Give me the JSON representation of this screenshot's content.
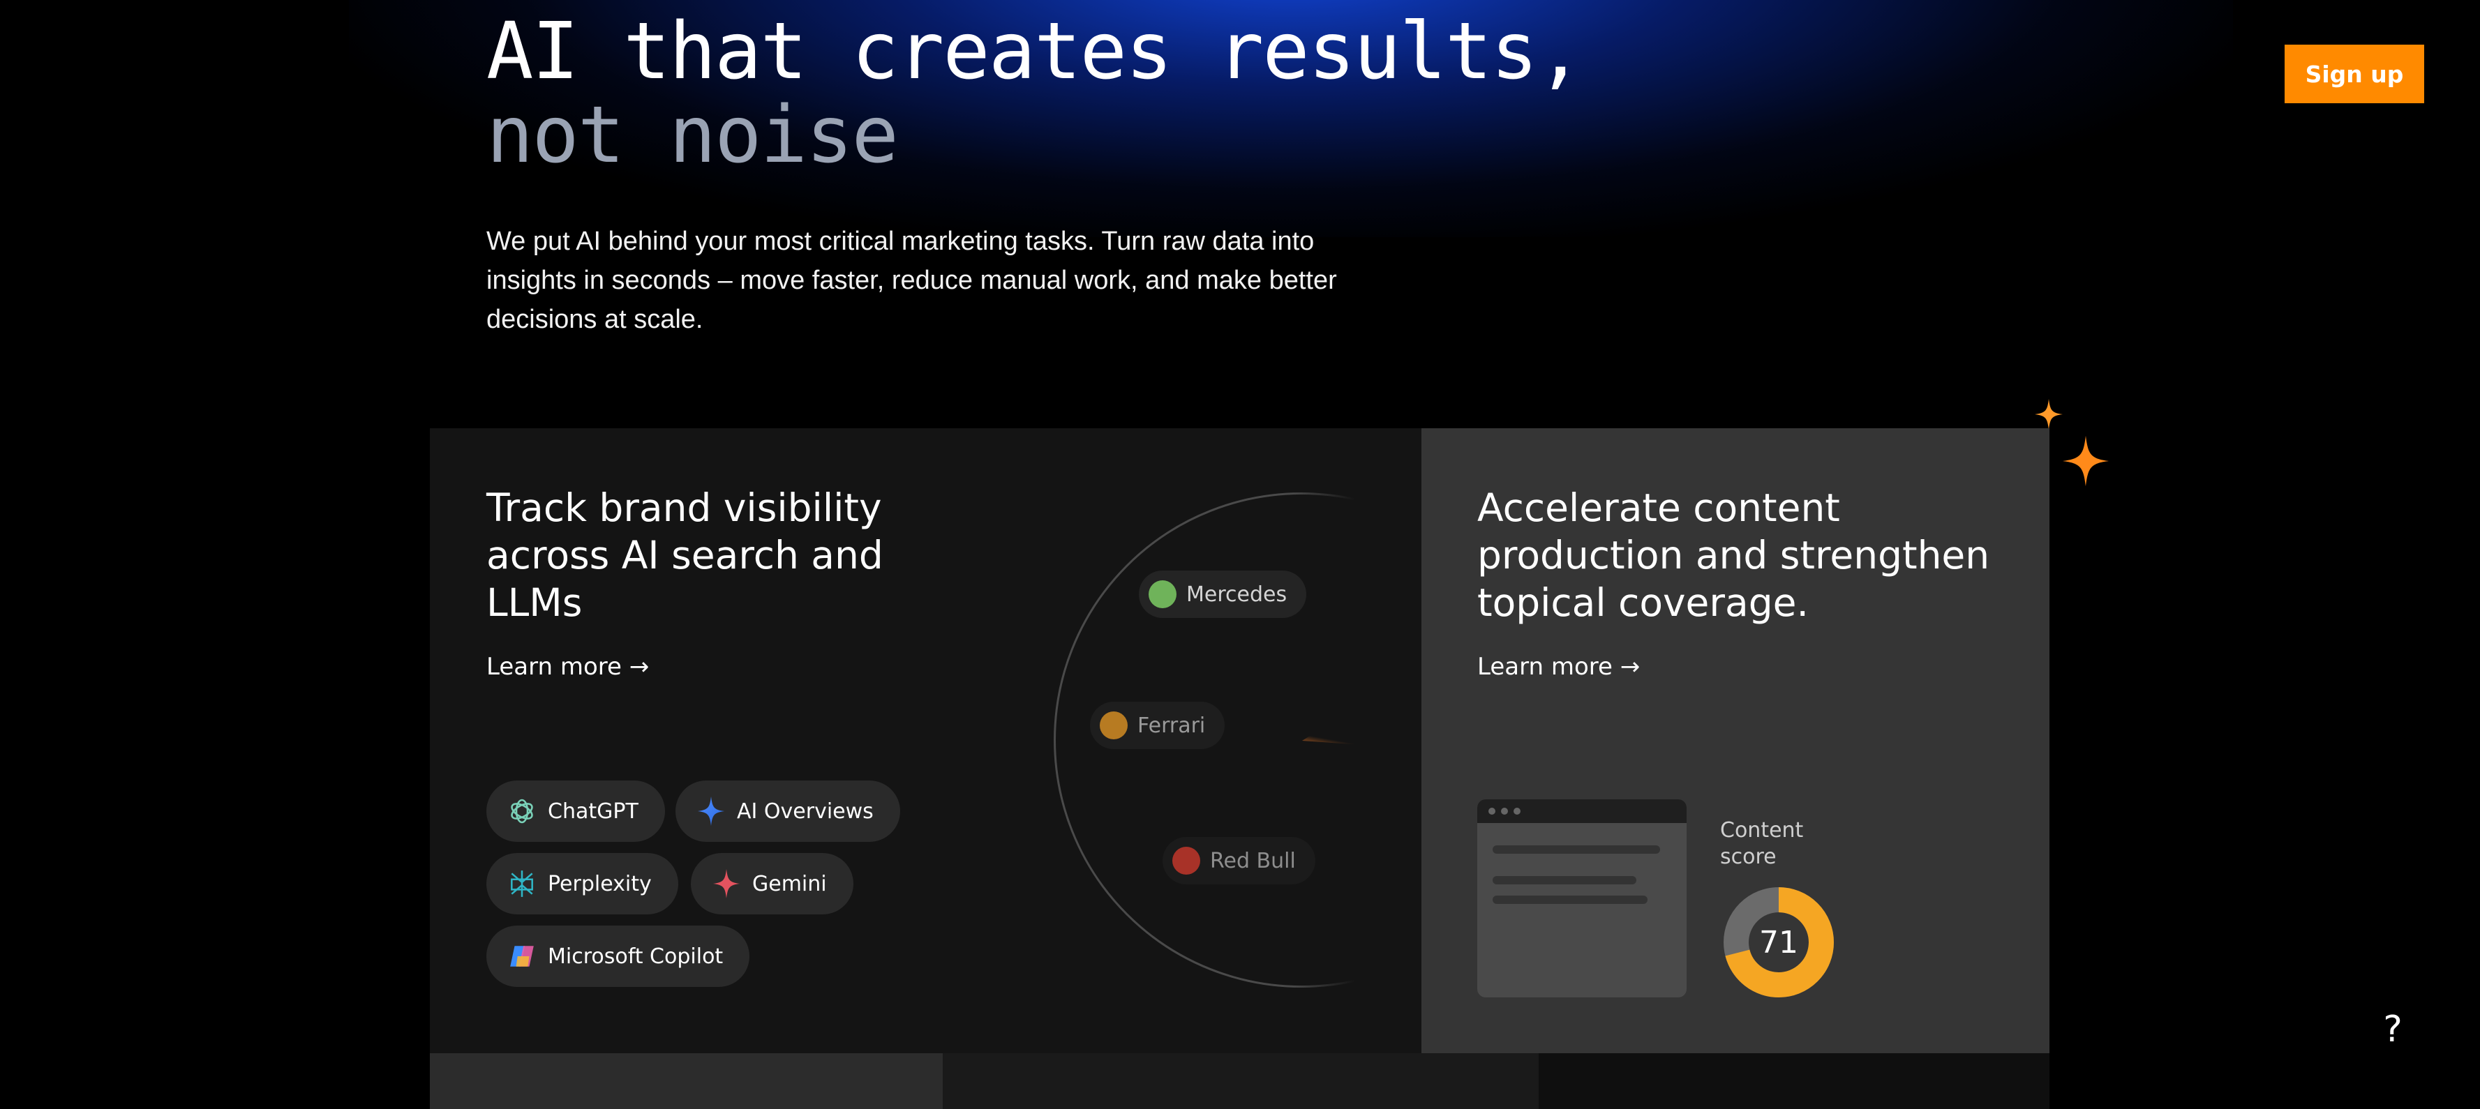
{
  "hero": {
    "title_line1": "AI that creates results,",
    "title_line2": "not noise",
    "subtitle": "We put AI behind your most critical marketing tasks. Turn raw data into insights in seconds – move faster, reduce manual work, and make better decisions at scale."
  },
  "header": {
    "signup_label": "Sign up"
  },
  "cards": {
    "visibility": {
      "title": "Track brand visibility across AI search and LLMs",
      "learn_more": "Learn more →",
      "platforms": [
        "ChatGPT",
        "AI Overviews",
        "Perplexity",
        "Gemini",
        "Microsoft Copilot"
      ],
      "brands": [
        "Mercedes",
        "Ferrari",
        "Red Bull"
      ]
    },
    "content": {
      "title": "Accelerate content production and strengthen topical coverage.",
      "learn_more": "Learn more →",
      "score_label": "Content score",
      "score_value": "71",
      "score_fraction": 0.71
    }
  },
  "help": {
    "label": "?"
  },
  "colors": {
    "accent": "#ff8a00",
    "card_dark": "#141414",
    "card_gray": "#353535",
    "score_ring": "#f5a623"
  },
  "icons": {
    "chatgpt": "openai-knot-icon",
    "ai_overviews": "sparkle-icon",
    "perplexity": "perplexity-icon",
    "gemini": "gemini-star-icon",
    "copilot": "copilot-icon"
  }
}
